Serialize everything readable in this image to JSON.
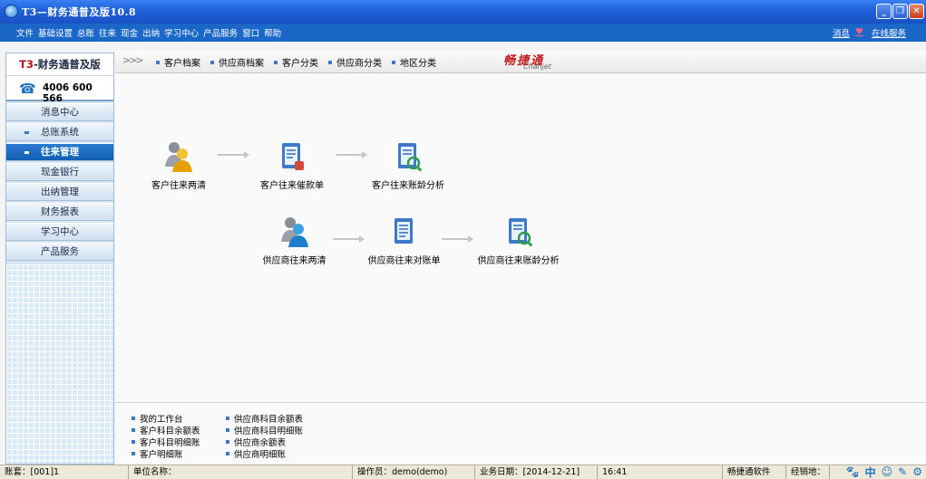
{
  "window": {
    "title": "T3—财务通普及版10.8",
    "minimize": "_",
    "restore": "❐",
    "close": "✕"
  },
  "menu": {
    "items": [
      "文件",
      "基础设置",
      "总账",
      "往来",
      "现金",
      "出纳",
      "学习中心",
      "产品服务",
      "窗口",
      "帮助"
    ],
    "right": {
      "message": "消息",
      "online_service": "在线服务"
    }
  },
  "sidebar": {
    "brand_prefix": "T3",
    "brand_rest": "-财务通普及版",
    "phone": "4006 600 566",
    "items": [
      {
        "label": "消息中心",
        "active": false,
        "bullet": false
      },
      {
        "label": "总账系统",
        "active": false,
        "bullet": true
      },
      {
        "label": "往来管理",
        "active": true,
        "bullet": true
      },
      {
        "label": "现金银行",
        "active": false,
        "bullet": false
      },
      {
        "label": "出纳管理",
        "active": false,
        "bullet": false
      },
      {
        "label": "财务报表",
        "active": false,
        "bullet": false
      },
      {
        "label": "学习中心",
        "active": false,
        "bullet": false
      },
      {
        "label": "产品服务",
        "active": false,
        "bullet": false
      }
    ]
  },
  "tabbar": {
    "chevron": ">>>",
    "tabs": [
      "客户档案",
      "供应商档案",
      "客户分类",
      "供应商分类",
      "地区分类"
    ],
    "logo_cn": "畅捷通",
    "logo_en": "Chanjet"
  },
  "flow": {
    "customer": [
      "客户往来两清",
      "客户往来催款单",
      "客户往来账龄分析"
    ],
    "supplier": [
      "供应商往来两清",
      "供应商往来对账单",
      "供应商往来账龄分析"
    ]
  },
  "quick_links": {
    "col1": [
      "我的工作台",
      "客户科目余额表",
      "客户科目明细账",
      "客户明细账"
    ],
    "col2": [
      "供应商科目余额表",
      "供应商科目明细账",
      "供应商余额表",
      "供应商明细账"
    ]
  },
  "status": {
    "account": "账套：[001]1",
    "company": "单位名称：",
    "operator": "操作员：demo(demo)",
    "business_date": "业务日期：[2014-12-21]",
    "time": "16:41",
    "vendor": "畅捷通软件",
    "dealer": "经销地："
  },
  "tray_icons": [
    "paw-icon",
    "chinese-input-icon",
    "smiley-icon",
    "pen-icon",
    "settings-icon"
  ]
}
